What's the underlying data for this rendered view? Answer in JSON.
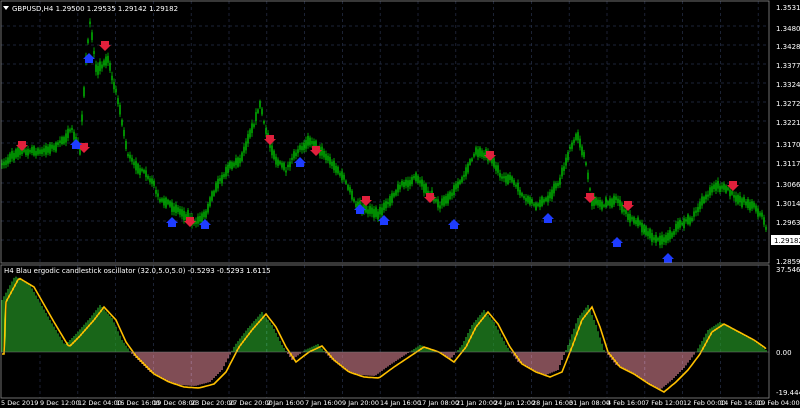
{
  "colors": {
    "background": "#000000",
    "grid": "#27304a",
    "bull_candle": "#00c800",
    "hist_positive": "#32cd32",
    "hist_negative": "#ff9aaa",
    "signal_line": "#ffc000",
    "up_arrow": "#1e3cff",
    "down_arrow": "#e0203c",
    "text": "#ffffff",
    "price_box_bg": "#ffffff",
    "price_box_text": "#000000"
  },
  "price_panel": {
    "title": "GBPUSD,H4  1.29500 1.29535 1.29142 1.29182",
    "current_price": "1.29182",
    "axis_labels": [
      "1.35311",
      "1.34800",
      "1.34280",
      "1.33770",
      "1.33245",
      "1.32725",
      "1.32210",
      "1.31700",
      "1.31175",
      "1.30665",
      "1.30140",
      "1.29630",
      "1.28595"
    ]
  },
  "oscillator_panel": {
    "title": "H4 Blau ergodic candlestick oscillator (32.0,5.0,5.0) -0.5293 -0.5293 1.6115",
    "axis_labels": [
      "37.5466",
      "0.00",
      "-19.4443"
    ]
  },
  "time_axis": {
    "labels": [
      "5 Dec 2019",
      "9 Dec 12:00",
      "12 Dec 04:00",
      "16 Dec 16:00",
      "19 Dec 08:00",
      "23 Dec 20:00",
      "27 Dec 20:00",
      "2 Jan 16:00",
      "7 Jan 16:00",
      "9 Jan 20:00",
      "14 Jan 16:00",
      "17 Jan 08:00",
      "21 Jan 20:00",
      "24 Jan 12:00",
      "28 Jan 16:00",
      "31 Jan 08:00",
      "4 Feb 16:00",
      "7 Feb 12:00",
      "12 Feb 00:00",
      "14 Feb 16:00",
      "19 Feb 04:00"
    ]
  }
}
